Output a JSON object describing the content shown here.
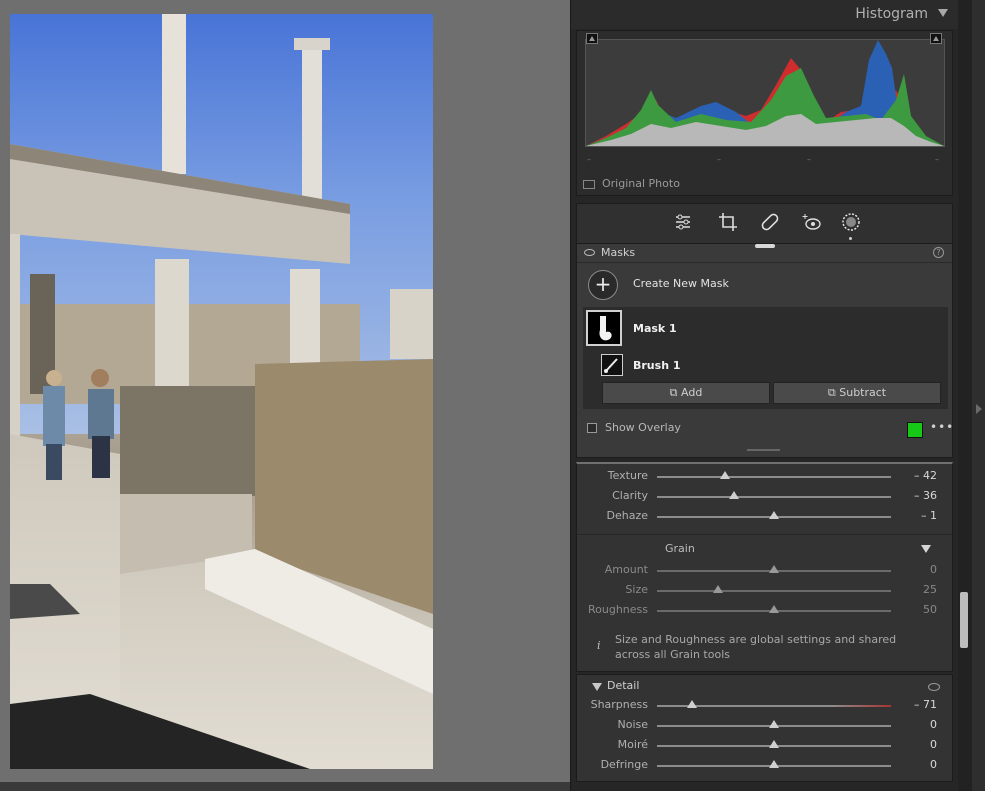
{
  "histogram": {
    "title": "Histogram",
    "original_photo_label": "Original Photo"
  },
  "tools": [
    "sliders-icon",
    "crop-icon",
    "healing-icon",
    "red-eye-icon",
    "masking-icon"
  ],
  "masks": {
    "title": "Masks",
    "create_label": "Create New Mask",
    "mask1_label": "Mask 1",
    "brush1_label": "Brush 1",
    "add_label": "Add",
    "subtract_label": "Subtract",
    "show_overlay_label": "Show Overlay",
    "overlay_color": "#16c916",
    "more_label": "•••"
  },
  "effects": {
    "rows": [
      {
        "label": "Texture",
        "value": "– 42",
        "pos": 0.29
      },
      {
        "label": "Clarity",
        "value": "– 36",
        "pos": 0.33
      },
      {
        "label": "Dehaze",
        "value": "– 1",
        "pos": 0.5
      }
    ]
  },
  "grain": {
    "title": "Grain",
    "rows": [
      {
        "label": "Amount",
        "value": "0",
        "pos": 0.5
      },
      {
        "label": "Size",
        "value": "25",
        "pos": 0.26
      },
      {
        "label": "Roughness",
        "value": "50",
        "pos": 0.5
      }
    ],
    "info": "Size and Roughness are global settings and shared across all Grain tools",
    "info_icon": "i"
  },
  "detail": {
    "title": "Detail",
    "rows": [
      {
        "label": "Sharpness",
        "value": "– 71",
        "pos": 0.15
      },
      {
        "label": "Noise",
        "value": "0",
        "pos": 0.5
      },
      {
        "label": "Moiré",
        "value": "0",
        "pos": 0.5
      },
      {
        "label": "Defringe",
        "value": "0",
        "pos": 0.5
      }
    ]
  }
}
